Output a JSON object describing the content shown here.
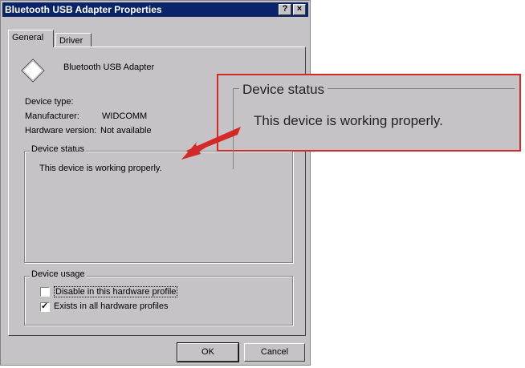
{
  "window": {
    "title": "Bluetooth USB Adapter Properties",
    "help_glyph": "?",
    "close_glyph": "×"
  },
  "tabs": [
    {
      "label": "General",
      "active": true
    },
    {
      "label": "Driver",
      "active": false
    }
  ],
  "device": {
    "icon": "diamond-device-icon",
    "name": "Bluetooth USB Adapter",
    "type_label": "Device type:",
    "type_value": "",
    "manufacturer_label": "Manufacturer:",
    "manufacturer_value": "WIDCOMM",
    "hardware_label": "Hardware version:",
    "hardware_value": "Not available"
  },
  "status": {
    "legend": "Device status",
    "text": "This device is working properly."
  },
  "usage": {
    "legend": "Device usage",
    "options": [
      {
        "label": "Disable in this hardware profile",
        "checked": false
      },
      {
        "label": "Exists in all hardware profiles",
        "checked": true
      }
    ]
  },
  "buttons": {
    "ok": "OK",
    "cancel": "Cancel"
  },
  "callout": {
    "legend": "Device status",
    "text": "This device is working properly.",
    "border_color": "#d42a27"
  },
  "check_glyph": "✓"
}
